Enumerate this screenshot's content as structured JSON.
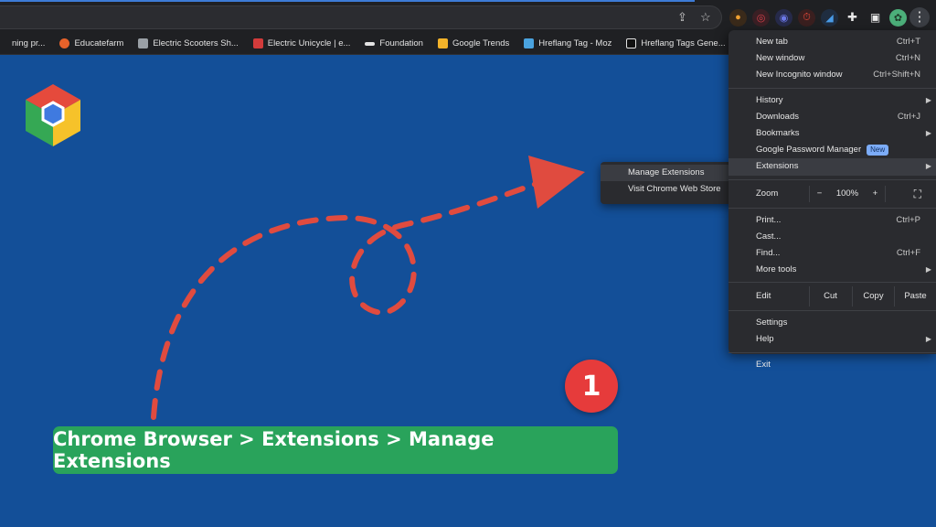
{
  "browser": {
    "bookmarks": [
      {
        "label": "ning pr...",
        "color": "#6a6a6a"
      },
      {
        "label": "Educatefarm",
        "color": "#e7622a"
      },
      {
        "label": "Electric Scooters Sh...",
        "color": "#9aa0a6"
      },
      {
        "label": "Electric Unicycle | e...",
        "color": "#d23b3b"
      },
      {
        "label": "Foundation",
        "color": "#e3e3e3"
      },
      {
        "label": "Google Trends",
        "color": "#f3b32a"
      },
      {
        "label": "Hreflang Tag - Moz",
        "color": "#4aa3df"
      },
      {
        "label": "Hreflang Tags Gene...",
        "color": "#111111"
      }
    ],
    "ext_icon_names": [
      "user-icon",
      "target-icon",
      "ring-icon",
      "timer-icon",
      "chart-icon",
      "puzzle-icon",
      "sidepanel-icon",
      "profile-avatar-icon"
    ],
    "kebab_glyph": "⋮"
  },
  "menu": {
    "new_tab": {
      "label": "New tab",
      "shortcut": "Ctrl+T"
    },
    "new_window": {
      "label": "New window",
      "shortcut": "Ctrl+N"
    },
    "new_incognito": {
      "label": "New Incognito window",
      "shortcut": "Ctrl+Shift+N"
    },
    "history": {
      "label": "History"
    },
    "downloads": {
      "label": "Downloads",
      "shortcut": "Ctrl+J"
    },
    "bookmarks": {
      "label": "Bookmarks"
    },
    "password_manager": {
      "label": "Google Password Manager",
      "badge": "New"
    },
    "extensions": {
      "label": "Extensions"
    },
    "zoom": {
      "label": "Zoom",
      "minus": "−",
      "value": "100%",
      "plus": "+"
    },
    "print": {
      "label": "Print...",
      "shortcut": "Ctrl+P"
    },
    "cast": {
      "label": "Cast..."
    },
    "find": {
      "label": "Find...",
      "shortcut": "Ctrl+F"
    },
    "more_tools": {
      "label": "More tools"
    },
    "edit": {
      "label": "Edit",
      "cut": "Cut",
      "copy": "Copy",
      "paste": "Paste"
    },
    "settings": {
      "label": "Settings"
    },
    "help": {
      "label": "Help"
    },
    "exit": {
      "label": "Exit"
    }
  },
  "submenu": {
    "manage_extensions": "Manage Extensions",
    "visit_store": "Visit Chrome Web Store"
  },
  "overlay": {
    "step_number": "1",
    "caption": "Chrome Browser > Extensions > Manage Extensions",
    "arrow_color": "#e04b3f",
    "badge_color": "#e63b3b",
    "caption_color": "#29a35b"
  }
}
